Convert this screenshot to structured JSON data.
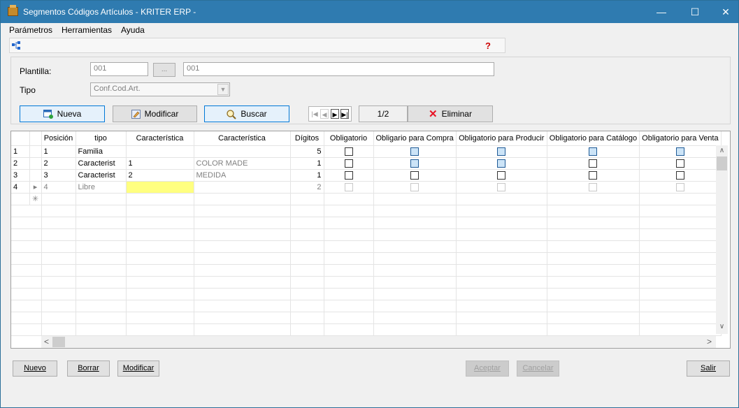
{
  "window": {
    "title": "Segmentos Códigos Artículos - KRITER ERP -",
    "min": "—",
    "max": "☐",
    "close": "✕"
  },
  "menu": [
    "Parámetros",
    "Herramientas",
    "Ayuda"
  ],
  "toolbar": {
    "help_glyph": "?"
  },
  "form": {
    "plantilla_label": "Plantilla:",
    "plantilla_code": "001",
    "plantilla_browse": "...",
    "plantilla_desc": "001",
    "tipo_label": "Tipo",
    "tipo_value": "Conf.Cod.Art."
  },
  "actions": {
    "nueva": "Nueva",
    "modificar": "Modificar",
    "buscar": "Buscar",
    "pager": "1/2",
    "eliminar": "Eliminar"
  },
  "grid": {
    "columns": [
      "Posición",
      "tipo",
      "Característica",
      "Característica",
      "Dígitos",
      "Obligatorio",
      "Obligario para Compra",
      "Obligatorio para Producir",
      "Obligatorio para Catálogo",
      "Obligatorio para Venta"
    ],
    "rows": [
      {
        "idx": "1",
        "marker": "",
        "pos": "1",
        "tipo": "Familia",
        "car1": "",
        "car2": "",
        "dig": "5"
      },
      {
        "idx": "2",
        "marker": "",
        "pos": "2",
        "tipo": "Caracterist",
        "car1": "1",
        "car2": "COLOR MADE",
        "dig": "1"
      },
      {
        "idx": "3",
        "marker": "",
        "pos": "3",
        "tipo": "Caracterist",
        "car1": "2",
        "car2": "MEDIDA",
        "dig": "1"
      },
      {
        "idx": "4",
        "marker": "▸",
        "pos": "4",
        "tipo": "Libre",
        "car1": "",
        "car2": "",
        "dig": "2"
      }
    ],
    "new_row_marker": "✳"
  },
  "bottom": {
    "nuevo": "Nuevo",
    "borrar": "Borrar",
    "modificar": "Modificar",
    "aceptar": "Aceptar",
    "cancelar": "Cancelar",
    "salir": "Salir"
  },
  "colors": {
    "titlebar": "#2f7bb0",
    "checkbox_blue": "#cce4f7",
    "highlight": "#ffff80"
  }
}
